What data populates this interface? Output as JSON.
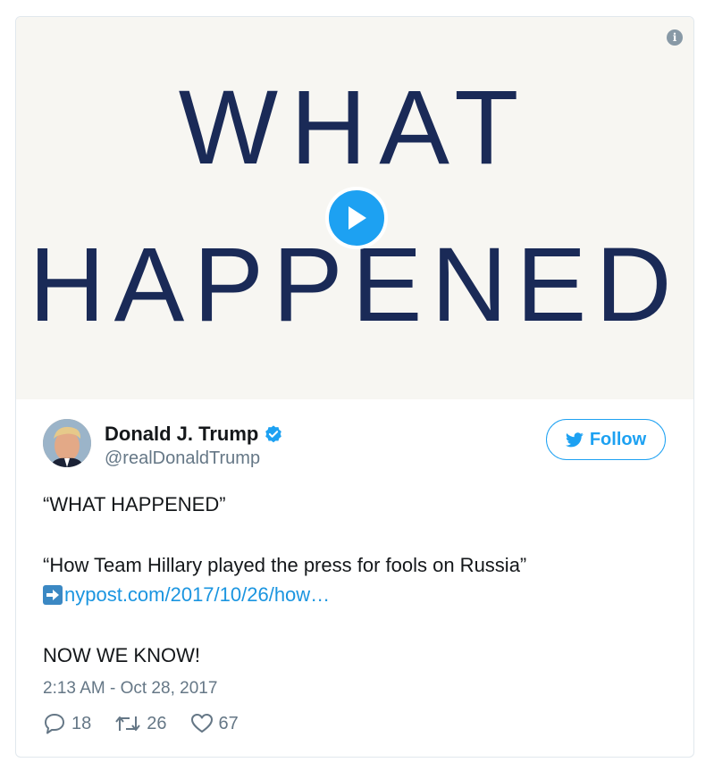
{
  "media": {
    "line1": "WHAT",
    "line2": "HAPPENED"
  },
  "author": {
    "name": "Donald J. Trump",
    "handle": "@realDonaldTrump"
  },
  "follow_label": "Follow",
  "tweet": {
    "line1": "“WHAT HAPPENED”",
    "line2": "“How Team Hillary played the press for fools on Russia”",
    "link": "nypost.com/2017/10/26/how…",
    "line3": "NOW WE KNOW!",
    "timestamp": "2:13 AM - Oct 28, 2017"
  },
  "stats": {
    "replies": "18",
    "retweets": "26",
    "likes": "67"
  },
  "colors": {
    "accent": "#1da1f2",
    "title_text": "#1a2a57",
    "muted": "#657786",
    "link": "#1b95e0"
  },
  "icons": [
    "info-icon",
    "play-icon",
    "verified-badge-icon",
    "twitter-bird-icon",
    "arrow-right-icon",
    "reply-icon",
    "retweet-icon",
    "like-icon"
  ]
}
